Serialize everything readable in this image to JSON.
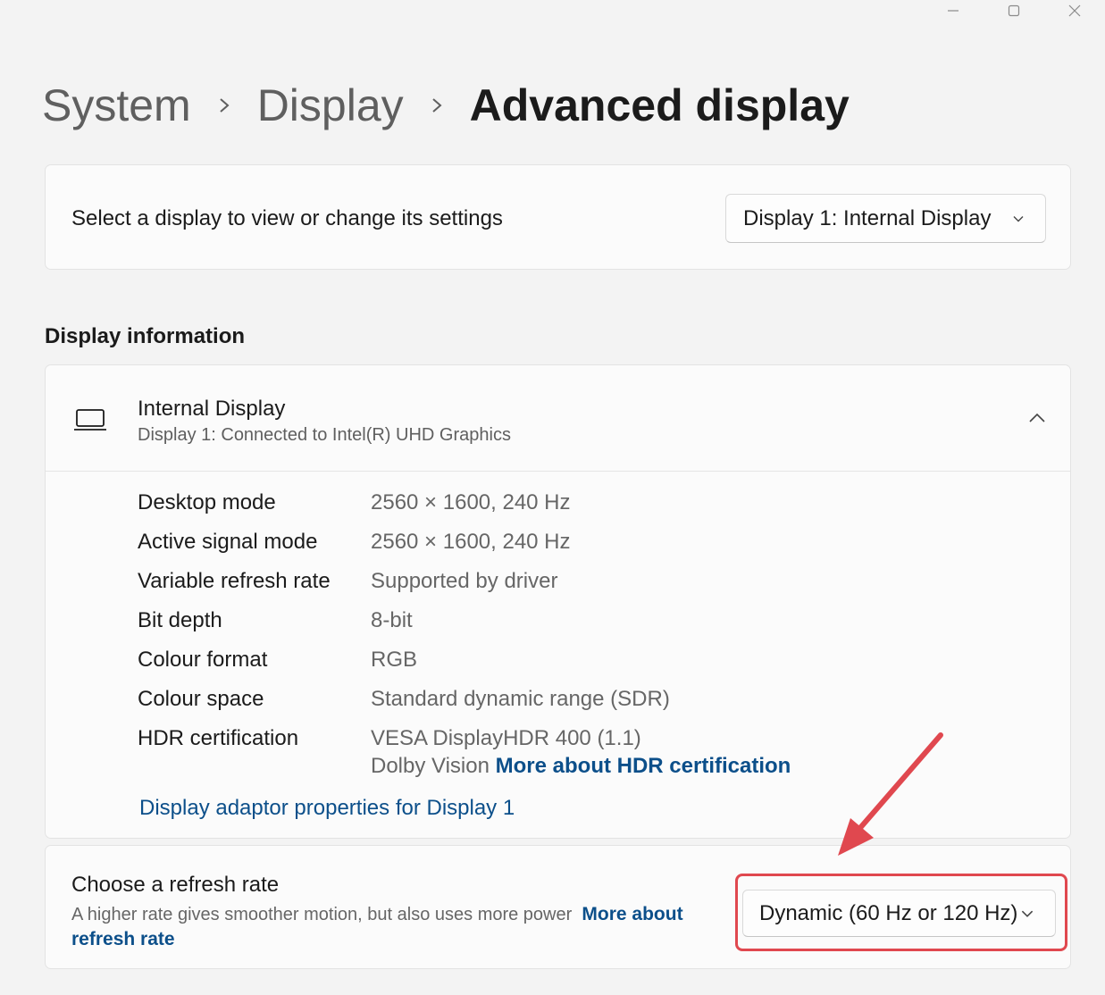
{
  "window_controls": {
    "minimize_icon": "minimize-icon",
    "maximize_icon": "maximize-icon",
    "close_icon": "close-icon"
  },
  "breadcrumb": {
    "items": [
      "System",
      "Display"
    ],
    "current": "Advanced display"
  },
  "display_select": {
    "label": "Select a display to view or change its settings",
    "selected": "Display 1: Internal Display"
  },
  "display_information": {
    "section_title": "Display information",
    "name": "Internal Display",
    "subtitle": "Display 1: Connected to Intel(R) UHD Graphics",
    "rows": [
      {
        "key": "Desktop mode",
        "value": "2560 × 1600, 240 Hz"
      },
      {
        "key": "Active signal mode",
        "value": "2560 × 1600, 240 Hz"
      },
      {
        "key": "Variable refresh rate",
        "value": "Supported by driver"
      },
      {
        "key": "Bit depth",
        "value": "8-bit"
      },
      {
        "key": "Colour format",
        "value": "RGB"
      },
      {
        "key": "Colour space",
        "value": "Standard dynamic range (SDR)"
      },
      {
        "key": "HDR certification",
        "value": "VESA DisplayHDR 400 (1.1)"
      }
    ],
    "hdr_extra": "Dolby Vision",
    "hdr_link": "More about HDR certification",
    "adaptor_link": "Display adaptor properties for Display 1"
  },
  "refresh_rate": {
    "title": "Choose a refresh rate",
    "description": "A higher rate gives smoother motion, but also uses more power",
    "link": "More about refresh rate",
    "selected": "Dynamic (60 Hz or 120 Hz)"
  },
  "colors": {
    "accent_link": "#0c4f8a",
    "annotation_red": "#e0484f"
  }
}
